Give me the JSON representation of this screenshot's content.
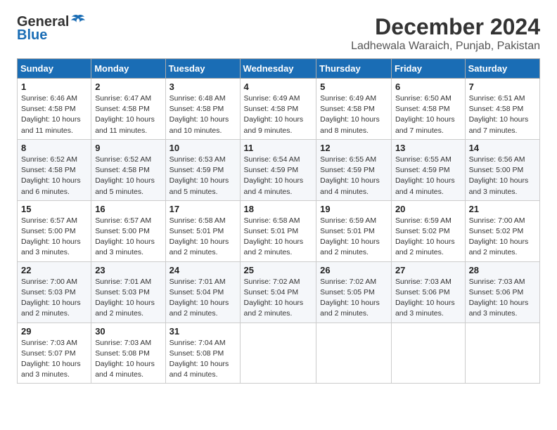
{
  "header": {
    "logo_general": "General",
    "logo_blue": "Blue",
    "month": "December 2024",
    "location": "Ladhewala Waraich, Punjab, Pakistan"
  },
  "weekdays": [
    "Sunday",
    "Monday",
    "Tuesday",
    "Wednesday",
    "Thursday",
    "Friday",
    "Saturday"
  ],
  "weeks": [
    [
      {
        "day": "1",
        "sunrise": "6:46 AM",
        "sunset": "4:58 PM",
        "daylight": "10 hours and 11 minutes."
      },
      {
        "day": "2",
        "sunrise": "6:47 AM",
        "sunset": "4:58 PM",
        "daylight": "10 hours and 11 minutes."
      },
      {
        "day": "3",
        "sunrise": "6:48 AM",
        "sunset": "4:58 PM",
        "daylight": "10 hours and 10 minutes."
      },
      {
        "day": "4",
        "sunrise": "6:49 AM",
        "sunset": "4:58 PM",
        "daylight": "10 hours and 9 minutes."
      },
      {
        "day": "5",
        "sunrise": "6:49 AM",
        "sunset": "4:58 PM",
        "daylight": "10 hours and 8 minutes."
      },
      {
        "day": "6",
        "sunrise": "6:50 AM",
        "sunset": "4:58 PM",
        "daylight": "10 hours and 7 minutes."
      },
      {
        "day": "7",
        "sunrise": "6:51 AM",
        "sunset": "4:58 PM",
        "daylight": "10 hours and 7 minutes."
      }
    ],
    [
      {
        "day": "8",
        "sunrise": "6:52 AM",
        "sunset": "4:58 PM",
        "daylight": "10 hours and 6 minutes."
      },
      {
        "day": "9",
        "sunrise": "6:52 AM",
        "sunset": "4:58 PM",
        "daylight": "10 hours and 5 minutes."
      },
      {
        "day": "10",
        "sunrise": "6:53 AM",
        "sunset": "4:59 PM",
        "daylight": "10 hours and 5 minutes."
      },
      {
        "day": "11",
        "sunrise": "6:54 AM",
        "sunset": "4:59 PM",
        "daylight": "10 hours and 4 minutes."
      },
      {
        "day": "12",
        "sunrise": "6:55 AM",
        "sunset": "4:59 PM",
        "daylight": "10 hours and 4 minutes."
      },
      {
        "day": "13",
        "sunrise": "6:55 AM",
        "sunset": "4:59 PM",
        "daylight": "10 hours and 4 minutes."
      },
      {
        "day": "14",
        "sunrise": "6:56 AM",
        "sunset": "5:00 PM",
        "daylight": "10 hours and 3 minutes."
      }
    ],
    [
      {
        "day": "15",
        "sunrise": "6:57 AM",
        "sunset": "5:00 PM",
        "daylight": "10 hours and 3 minutes."
      },
      {
        "day": "16",
        "sunrise": "6:57 AM",
        "sunset": "5:00 PM",
        "daylight": "10 hours and 3 minutes."
      },
      {
        "day": "17",
        "sunrise": "6:58 AM",
        "sunset": "5:01 PM",
        "daylight": "10 hours and 2 minutes."
      },
      {
        "day": "18",
        "sunrise": "6:58 AM",
        "sunset": "5:01 PM",
        "daylight": "10 hours and 2 minutes."
      },
      {
        "day": "19",
        "sunrise": "6:59 AM",
        "sunset": "5:01 PM",
        "daylight": "10 hours and 2 minutes."
      },
      {
        "day": "20",
        "sunrise": "6:59 AM",
        "sunset": "5:02 PM",
        "daylight": "10 hours and 2 minutes."
      },
      {
        "day": "21",
        "sunrise": "7:00 AM",
        "sunset": "5:02 PM",
        "daylight": "10 hours and 2 minutes."
      }
    ],
    [
      {
        "day": "22",
        "sunrise": "7:00 AM",
        "sunset": "5:03 PM",
        "daylight": "10 hours and 2 minutes."
      },
      {
        "day": "23",
        "sunrise": "7:01 AM",
        "sunset": "5:03 PM",
        "daylight": "10 hours and 2 minutes."
      },
      {
        "day": "24",
        "sunrise": "7:01 AM",
        "sunset": "5:04 PM",
        "daylight": "10 hours and 2 minutes."
      },
      {
        "day": "25",
        "sunrise": "7:02 AM",
        "sunset": "5:04 PM",
        "daylight": "10 hours and 2 minutes."
      },
      {
        "day": "26",
        "sunrise": "7:02 AM",
        "sunset": "5:05 PM",
        "daylight": "10 hours and 2 minutes."
      },
      {
        "day": "27",
        "sunrise": "7:03 AM",
        "sunset": "5:06 PM",
        "daylight": "10 hours and 3 minutes."
      },
      {
        "day": "28",
        "sunrise": "7:03 AM",
        "sunset": "5:06 PM",
        "daylight": "10 hours and 3 minutes."
      }
    ],
    [
      {
        "day": "29",
        "sunrise": "7:03 AM",
        "sunset": "5:07 PM",
        "daylight": "10 hours and 3 minutes."
      },
      {
        "day": "30",
        "sunrise": "7:03 AM",
        "sunset": "5:08 PM",
        "daylight": "10 hours and 4 minutes."
      },
      {
        "day": "31",
        "sunrise": "7:04 AM",
        "sunset": "5:08 PM",
        "daylight": "10 hours and 4 minutes."
      },
      null,
      null,
      null,
      null
    ]
  ]
}
